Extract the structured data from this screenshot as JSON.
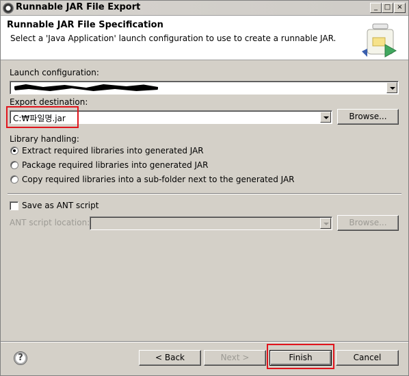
{
  "window": {
    "title": "Runnable JAR File Export",
    "controls": [
      "_",
      "□",
      "×"
    ]
  },
  "header": {
    "title": "Runnable JAR File Specification",
    "description": "Select a 'Java Application' launch configuration to use to create a runnable JAR."
  },
  "launch_config": {
    "label": "Launch configuration:",
    "value_redacted": true
  },
  "export_destination": {
    "label": "Export destination:",
    "value": "C:₩파일명.jar",
    "browse_label": "Browse..."
  },
  "library_handling": {
    "label": "Library handling:",
    "options": [
      {
        "label": "Extract required libraries into generated JAR",
        "selected": true
      },
      {
        "label": "Package required libraries into generated JAR",
        "selected": false
      },
      {
        "label": "Copy required libraries into a sub-folder next to the generated JAR",
        "selected": false
      }
    ]
  },
  "ant": {
    "checkbox_label": "Save as ANT script",
    "checked": false,
    "location_label": "ANT script location:",
    "browse_label": "Browse..."
  },
  "footer": {
    "help_icon": "?",
    "back_label": "< Back",
    "next_label": "Next >",
    "finish_label": "Finish",
    "cancel_label": "Cancel"
  },
  "colors": {
    "highlight": "#e0141c",
    "dialog_bg": "#d4d0c8"
  }
}
